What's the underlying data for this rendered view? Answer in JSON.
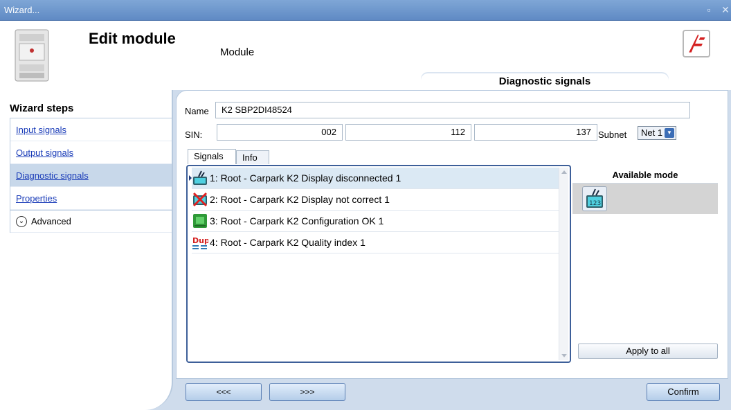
{
  "window": {
    "title": "Wizard..."
  },
  "header": {
    "title": "Edit module",
    "subtitle": "Module",
    "section_tab": "Diagnostic signals"
  },
  "wizard": {
    "title": "Wizard steps",
    "steps": [
      {
        "label": "Input signals"
      },
      {
        "label": "Output signals"
      },
      {
        "label": "Diagnostic signals"
      },
      {
        "label": "Properties"
      }
    ],
    "advanced_label": "Advanced"
  },
  "form": {
    "name_label": "Name",
    "name_value": "K2 SBP2DI48524",
    "sin_label": "SIN:",
    "sin_values": [
      "002",
      "112",
      "137"
    ],
    "subnet_label": "Subnet",
    "subnet_value": "Net 1"
  },
  "tabs": [
    {
      "label": "Signals"
    },
    {
      "label": "Info"
    }
  ],
  "signals": [
    {
      "text": "1: Root - Carpark K2 Display disconnected 1",
      "icon": "display-disconnected-icon"
    },
    {
      "text": "2: Root - Carpark K2 Display not correct 1",
      "icon": "display-not-correct-icon"
    },
    {
      "text": "3: Root - Carpark K2 Configuration OK 1",
      "icon": "configuration-ok-icon"
    },
    {
      "text": "4: Root - Carpark K2 Quality index 1",
      "icon": "quality-index-icon"
    }
  ],
  "mode_panel": {
    "title": "Available mode",
    "apply_label": "Apply to all",
    "mode_icon": "display-counter-icon"
  },
  "nav": {
    "prev_label": "<<<",
    "next_label": ">>>",
    "confirm_label": "Confirm"
  },
  "colors": {
    "titlebar": "#6b95cc",
    "accent": "#3d5f99",
    "link": "#1a3cb8",
    "selected_row": "#dbe9f4"
  }
}
